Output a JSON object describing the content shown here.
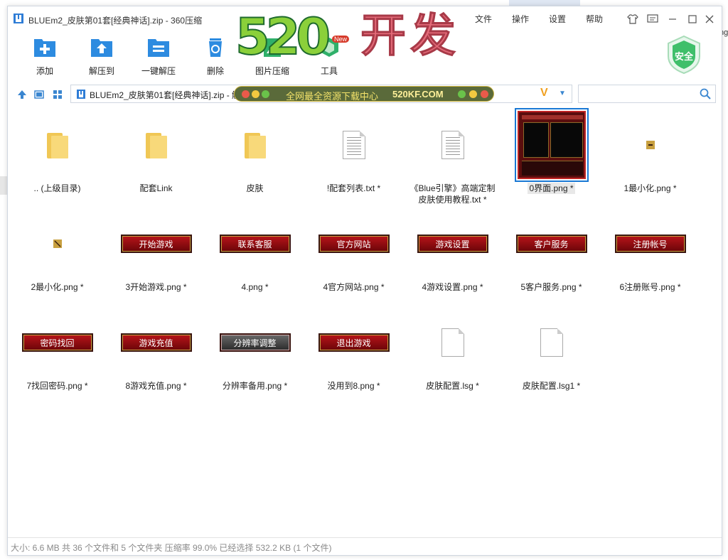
{
  "window": {
    "title": "BLUEm2_皮肤第01套[经典神话].zip - 360压缩"
  },
  "menu": [
    "文件",
    "操作",
    "设置",
    "帮助"
  ],
  "background": {
    "right_text": "ng"
  },
  "toolbar": {
    "items": [
      {
        "label": "添加",
        "icon": "add-icon"
      },
      {
        "label": "解压到",
        "icon": "extract-to-icon"
      },
      {
        "label": "一键解压",
        "icon": "one-click-extract-icon"
      },
      {
        "label": "删除",
        "icon": "delete-icon"
      },
      {
        "label": "图片压缩",
        "icon": "image-compress-icon"
      },
      {
        "label": "工具",
        "icon": "tools-icon"
      }
    ],
    "new_badge": "New",
    "safe_label": "安全"
  },
  "watermark": {
    "number": "520",
    "text": "开发",
    "banner_text": "全网最全资源下载中心",
    "banner_domain": "520KF.COM"
  },
  "address": {
    "path": "BLUEm2_皮肤第01套[经典神话].zip - 解包大小为 6.6 MB",
    "search_placeholder": ""
  },
  "files": [
    {
      "name": ".. (上级目录)",
      "type": "folder"
    },
    {
      "name": "配套Link",
      "type": "folder"
    },
    {
      "name": "皮肤",
      "type": "folder"
    },
    {
      "name": "!配套列表.txt *",
      "type": "txt"
    },
    {
      "name": "《Blue引擎》高端定制皮肤使用教程.txt *",
      "type": "txt"
    },
    {
      "name": "0界面.png *",
      "type": "ui",
      "selected": true
    },
    {
      "name": "1最小化.png *",
      "type": "tiny"
    },
    {
      "name": "2最小化.png *",
      "type": "tiny2"
    },
    {
      "name": "3开始游戏.png *",
      "type": "btn",
      "caption": "开始游戏"
    },
    {
      "name": "4.png *",
      "type": "btn",
      "caption": "联系客服"
    },
    {
      "name": "4官方网站.png *",
      "type": "btn",
      "caption": "官方网站"
    },
    {
      "name": "4游戏设置.png *",
      "type": "btn",
      "caption": "游戏设置"
    },
    {
      "name": "5客户服务.png *",
      "type": "btn",
      "caption": "客户服务"
    },
    {
      "name": "6注册账号.png *",
      "type": "btn",
      "caption": "注册帐号"
    },
    {
      "name": "7找回密码.png *",
      "type": "btn",
      "caption": "密码找回"
    },
    {
      "name": "8游戏充值.png *",
      "type": "btn",
      "caption": "游戏充值"
    },
    {
      "name": "分辨率备用.png *",
      "type": "btn-dark",
      "caption": "分辨率调整"
    },
    {
      "name": "没用到8.png *",
      "type": "btn",
      "caption": "退出游戏"
    },
    {
      "name": "皮肤配置.lsg *",
      "type": "blank"
    },
    {
      "name": "皮肤配置.lsg1 *",
      "type": "blank"
    }
  ],
  "status": {
    "text": "大小: 6.6 MB 共 36 个文件和 5 个文件夹 压缩率 99.0% 已经选择 532.2 KB (1 个文件)"
  },
  "colors": {
    "accent": "#1a78d4",
    "button_red": "#b8141a",
    "folder": "#f8d97a",
    "watermark_green": "#8bd03a",
    "watermark_pink": "#e36a78"
  }
}
